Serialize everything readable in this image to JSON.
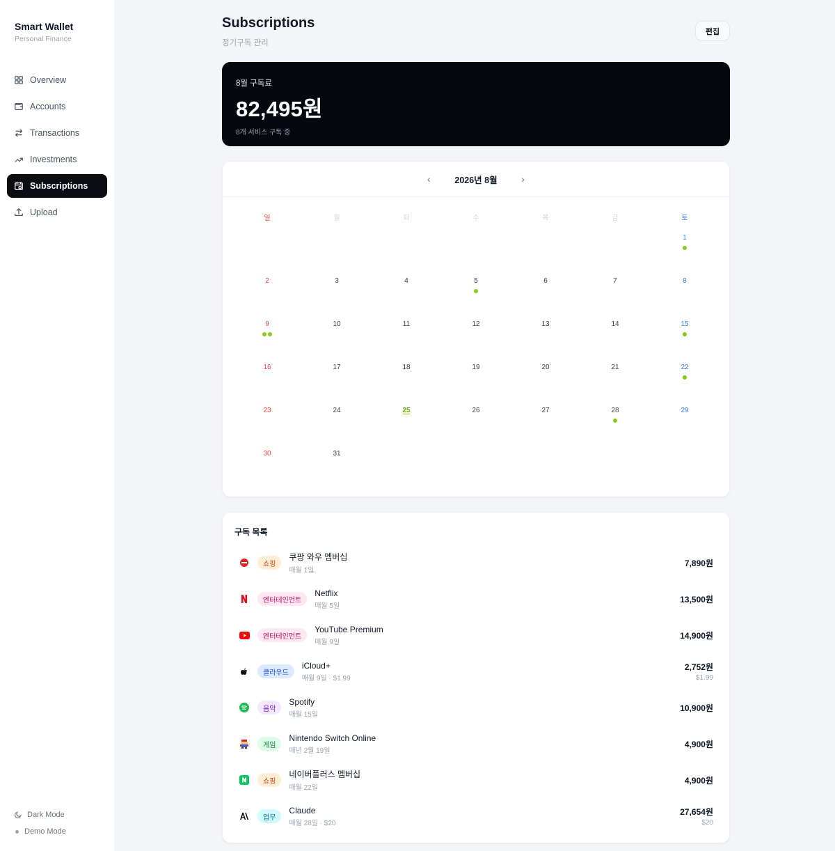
{
  "brand": {
    "title": "Smart Wallet",
    "subtitle": "Personal Finance"
  },
  "nav": [
    {
      "label": "Overview",
      "icon": "grid-icon",
      "active": false
    },
    {
      "label": "Accounts",
      "icon": "wallet-icon",
      "active": false
    },
    {
      "label": "Transactions",
      "icon": "swap-icon",
      "active": false
    },
    {
      "label": "Investments",
      "icon": "trend-up-icon",
      "active": false
    },
    {
      "label": "Subscriptions",
      "icon": "calendar-clock-icon",
      "active": true
    },
    {
      "label": "Upload",
      "icon": "upload-icon",
      "active": false
    }
  ],
  "footer": {
    "dark_mode": "Dark Mode",
    "demo_mode": "Demo Mode"
  },
  "header": {
    "title": "Subscriptions",
    "subtitle": "정기구독 관리",
    "edit_label": "편집"
  },
  "summary": {
    "label": "8월 구독료",
    "amount": "82,495원",
    "count_text": "8개 서비스 구독 중"
  },
  "calendar": {
    "month_label": "2026년 8월",
    "prev_icon": "chevron-left-icon",
    "next_icon": "chevron-right-icon",
    "weekdays": [
      "일",
      "월",
      "화",
      "수",
      "목",
      "금",
      "토"
    ],
    "first_weekday": 6,
    "days_in_month": 31,
    "today": 25,
    "payment_dots": {
      "1": 1,
      "5": 1,
      "9": 2,
      "15": 1,
      "22": 1,
      "28": 1
    },
    "accent": "#84cc16"
  },
  "list": {
    "title": "구독 목록",
    "items": [
      {
        "icon": "coupang-icon",
        "category": "쇼핑",
        "cat_bg": "#ffedd5",
        "cat_fg": "#c2410c",
        "name": "쿠팡 와우 멤버십",
        "cycle": "매월 1일",
        "price": "7,890원",
        "usd": ""
      },
      {
        "icon": "netflix-icon",
        "category": "엔터테인먼트",
        "cat_bg": "#fce7f3",
        "cat_fg": "#be185d",
        "name": "Netflix",
        "cycle": "매월 5일",
        "price": "13,500원",
        "usd": ""
      },
      {
        "icon": "youtube-icon",
        "category": "엔터테인먼트",
        "cat_bg": "#fce7f3",
        "cat_fg": "#be185d",
        "name": "YouTube Premium",
        "cycle": "매월 9일",
        "price": "14,900원",
        "usd": ""
      },
      {
        "icon": "apple-icon",
        "category": "클라우드",
        "cat_bg": "#dbeafe",
        "cat_fg": "#1d4ed8",
        "name": "iCloud+",
        "cycle": "매월 9일 · $1.99",
        "price": "2,752원",
        "usd": "$1.99"
      },
      {
        "icon": "spotify-icon",
        "category": "음악",
        "cat_bg": "#f3e8ff",
        "cat_fg": "#7e22ce",
        "name": "Spotify",
        "cycle": "매월 15일",
        "price": "10,900원",
        "usd": ""
      },
      {
        "icon": "nintendo-mario-icon",
        "category": "게임",
        "cat_bg": "#dcfce7",
        "cat_fg": "#15803d",
        "name": "Nintendo Switch Online",
        "cycle": "매년 2월 19일",
        "price": "4,900원",
        "usd": ""
      },
      {
        "icon": "naver-icon",
        "category": "쇼핑",
        "cat_bg": "#ffedd5",
        "cat_fg": "#c2410c",
        "name": "네이버플러스 멤버십",
        "cycle": "매월 22일",
        "price": "4,900원",
        "usd": ""
      },
      {
        "icon": "anthropic-icon",
        "category": "업무",
        "cat_bg": "#cffafe",
        "cat_fg": "#0e7490",
        "name": "Claude",
        "cycle": "매월 28일 · $20",
        "price": "27,654원",
        "usd": "$20"
      }
    ]
  }
}
